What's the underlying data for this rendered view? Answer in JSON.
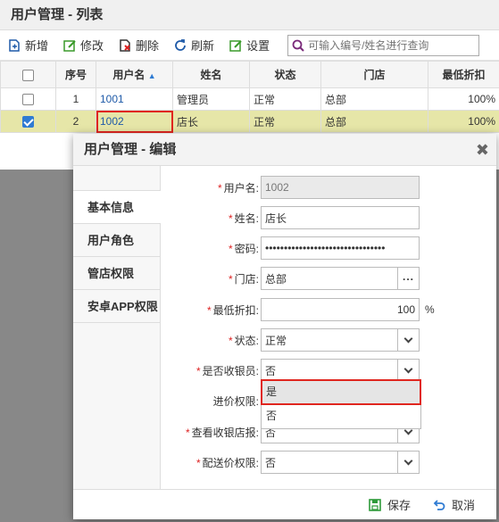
{
  "list": {
    "title": "用户管理 - 列表",
    "toolbar": {
      "add": "新增",
      "edit": "修改",
      "delete": "删除",
      "refresh": "刷新",
      "settings": "设置",
      "search_placeholder": "可输入编号/姓名进行查询"
    },
    "columns": [
      "序号",
      "用户名",
      "姓名",
      "状态",
      "门店",
      "最低折扣"
    ],
    "rows": [
      {
        "idx": "1",
        "username": "1001",
        "name": "管理员",
        "status": "正常",
        "store": "总部",
        "discount": "100%"
      },
      {
        "idx": "2",
        "username": "1002",
        "name": "店长",
        "status": "正常",
        "store": "总部",
        "discount": "100%"
      }
    ]
  },
  "dialog": {
    "title": "用户管理 - 编辑",
    "tabs": [
      "基本信息",
      "用户角色",
      "管店权限",
      "安卓APP权限"
    ],
    "form": {
      "username_label": "用户名:",
      "username": "1002",
      "name_label": "姓名:",
      "name": "店长",
      "password_label": "密码:",
      "password": "••••••••••••••••••••••••••••••••",
      "store_label": "门店:",
      "store": "总部",
      "discount_label": "最低折扣:",
      "discount": "100",
      "discount_unit": "%",
      "status_label": "状态:",
      "status": "正常",
      "cashier_label": "是否收银员:",
      "cashier": "否",
      "purchase_label": "进价权限:",
      "view_cashier_label": "查看收银店报:",
      "view_cashier": "否",
      "delivery_label": "配送价权限:",
      "delivery": "否"
    },
    "dropdown_options": [
      "是",
      "否"
    ],
    "save": "保存",
    "cancel": "取消"
  },
  "colors": {
    "selected_row": "#e6e6a8",
    "highlight": "#e0261f",
    "link": "#1e5aa8"
  }
}
